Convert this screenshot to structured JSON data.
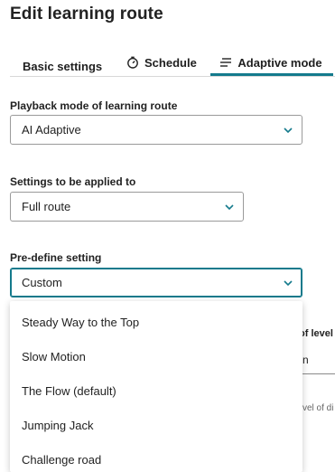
{
  "page": {
    "title": "Edit learning route"
  },
  "tabs": [
    {
      "label": "Basic settings",
      "icon": ""
    },
    {
      "label": "Schedule",
      "icon": "stopwatch-icon"
    },
    {
      "label": "Adaptive mode",
      "icon": "lines-icon",
      "active": true
    }
  ],
  "accent_color": "#147a8c",
  "fields": {
    "playback": {
      "label": "Playback mode of learning route",
      "value": "AI Adaptive"
    },
    "applied_to": {
      "label": "Settings to be applied to",
      "value": "Full route"
    },
    "predefine": {
      "label": "Pre-define setting",
      "value": "Custom"
    }
  },
  "dropdown": {
    "options": [
      "Steady Way to the Top",
      "Slow Motion",
      "The Flow (default)",
      "Jumping Jack",
      "Challenge road"
    ]
  },
  "background_fragments": {
    "col_header": "of level",
    "cell": "n",
    "hint": "vel of di"
  }
}
